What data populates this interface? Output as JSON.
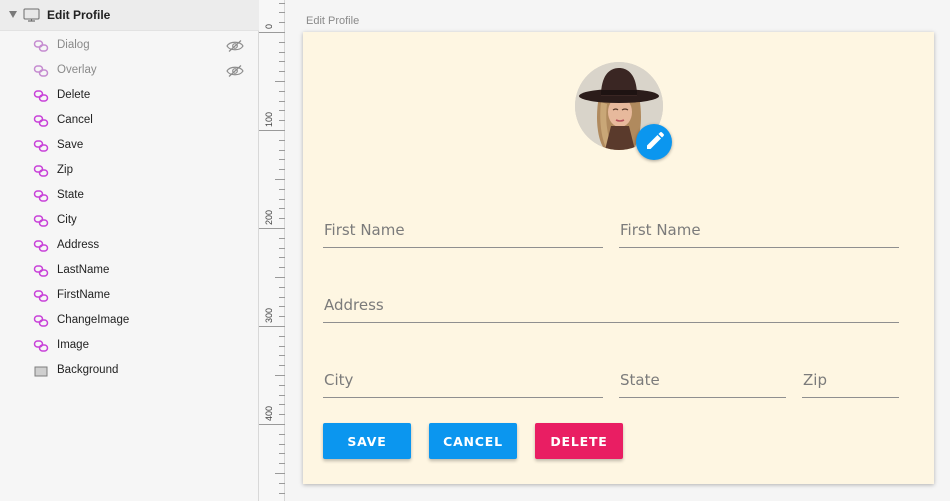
{
  "layers_panel": {
    "group_label": "Edit Profile",
    "items": [
      {
        "label": "Dialog",
        "type": "symbol",
        "hidden": true
      },
      {
        "label": "Overlay",
        "type": "symbol",
        "hidden": true
      },
      {
        "label": "Delete",
        "type": "symbol",
        "hidden": false
      },
      {
        "label": "Cancel",
        "type": "symbol",
        "hidden": false
      },
      {
        "label": "Save",
        "type": "symbol",
        "hidden": false
      },
      {
        "label": "Zip",
        "type": "symbol",
        "hidden": false
      },
      {
        "label": "State",
        "type": "symbol",
        "hidden": false
      },
      {
        "label": "City",
        "type": "symbol",
        "hidden": false
      },
      {
        "label": "Address",
        "type": "symbol",
        "hidden": false
      },
      {
        "label": "LastName",
        "type": "symbol",
        "hidden": false
      },
      {
        "label": "FirstName",
        "type": "symbol",
        "hidden": false
      },
      {
        "label": "ChangeImage",
        "type": "symbol",
        "hidden": false
      },
      {
        "label": "Image",
        "type": "symbol",
        "hidden": false
      },
      {
        "label": "Background",
        "type": "rectangle",
        "hidden": false
      }
    ]
  },
  "ruler": {
    "labels": [
      "0",
      "100",
      "200",
      "300",
      "400"
    ]
  },
  "artboard": {
    "title": "Edit Profile",
    "form": {
      "first_name_placeholder": "First Name",
      "last_name_placeholder": "First Name",
      "address_placeholder": "Address",
      "city_placeholder": "City",
      "state_placeholder": "State",
      "zip_placeholder": "Zip"
    },
    "buttons": {
      "save": "SAVE",
      "cancel": "CANCEL",
      "delete": "DELETE"
    }
  },
  "colors": {
    "artboard_bg": "#fef6e2",
    "primary": "#0b96ef",
    "danger": "#e91e63",
    "symbol_icon": "#c840d8"
  },
  "icons": {
    "group": "artboard-icon",
    "symbol": "symbol-link-icon",
    "rectangle": "rectangle-icon",
    "hidden": "eye-hidden-icon",
    "edit": "pencil-icon"
  }
}
